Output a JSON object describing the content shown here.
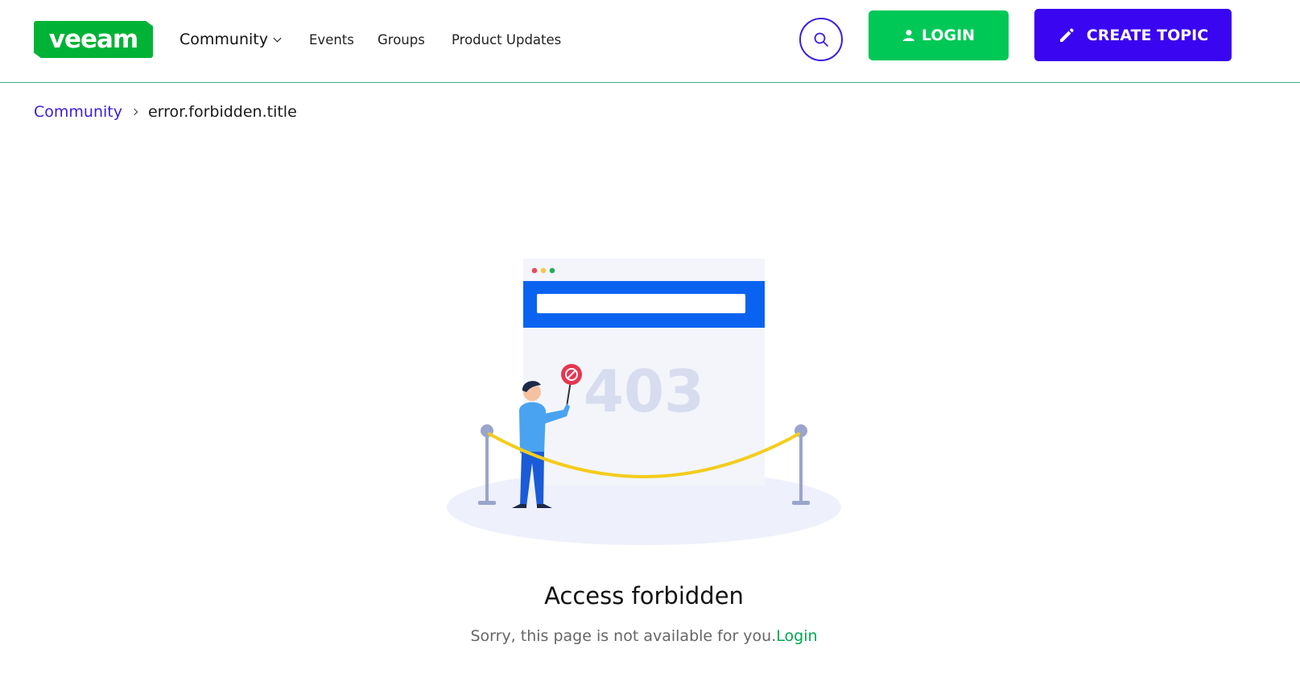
{
  "brand": {
    "logo_text": "veeam",
    "primary_green": "#00b336",
    "accent_purple": "#3a05f0"
  },
  "nav": {
    "community": "Community",
    "events": "Events",
    "groups": "Groups",
    "product_updates": "Product Updates"
  },
  "header_actions": {
    "search_icon": "search-icon",
    "login_label": "LOGIN",
    "create_topic_label": "CREATE TOPIC"
  },
  "breadcrumb": {
    "root": "Community",
    "current": "error.forbidden.title"
  },
  "illustration": {
    "code": "403"
  },
  "error": {
    "title": "Access forbidden",
    "message": "Sorry, this page is not available for you.",
    "login_link": "Login"
  }
}
